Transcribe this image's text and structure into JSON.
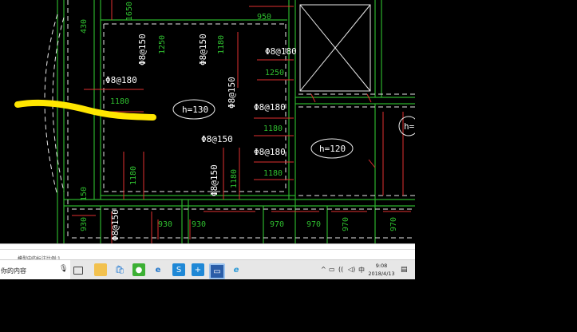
{
  "drawing": {
    "top_labels": [
      "1650",
      "950"
    ],
    "side_label": "430",
    "rebar_labels": [
      "Φ8@150",
      "Φ8@150",
      "Φ8@180",
      "Φ8@180",
      "Φ8@150",
      "Φ8@180",
      "Φ8@180",
      "Φ8@150",
      "Φ8@150",
      "Φ8@150"
    ],
    "dim_labels": [
      "1250",
      "1180",
      "1180",
      "1180",
      "1180",
      "1180",
      "1250",
      "1180",
      "150",
      "930",
      "930",
      "930",
      "970",
      "970",
      "970",
      "970"
    ],
    "slab_labels": [
      "h=130",
      "h=120",
      "h="
    ]
  },
  "statusbar": {
    "scale_text": "模型中的标注比例:1"
  },
  "taskbar": {
    "search_text": "你的内容",
    "mic_icon": "microphone-icon",
    "apps": [
      "task-view-icon",
      "file-explorer-icon",
      "store-icon",
      "wechat-icon",
      "edge-icon",
      "app-icon",
      "app-icon",
      "cad-icon",
      "ie-icon"
    ],
    "tray": {
      "ime": "中",
      "time": "9:08",
      "date": "2018/4/13"
    }
  },
  "colors": {
    "annotation_yellow": "#ffe600",
    "dimension_green": "#2fbf2f",
    "wall_green": "#2bb02b",
    "hatch_red": "#e03030",
    "rebar_white": "#ffffff"
  }
}
